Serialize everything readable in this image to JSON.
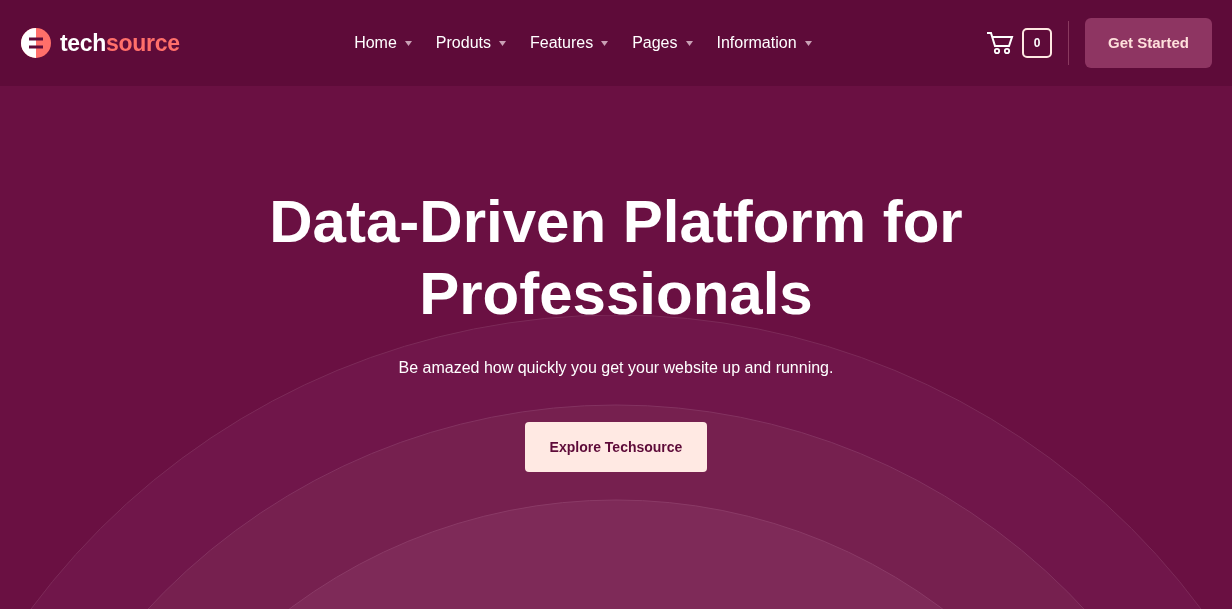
{
  "logo": {
    "prefix": "tech",
    "suffix": "source"
  },
  "nav": [
    {
      "label": "Home",
      "has_menu": true
    },
    {
      "label": "Produts",
      "has_menu": true
    },
    {
      "label": "Features",
      "has_menu": true
    },
    {
      "label": "Pages",
      "has_menu": true
    },
    {
      "label": "Information",
      "has_menu": true
    }
  ],
  "cart": {
    "count": "0"
  },
  "cta_button": "Get Started",
  "hero": {
    "title": "Data-Driven Platform for Professionals",
    "subtitle": "Be amazed how quickly you get your website up and running.",
    "button": "Explore Techsource"
  }
}
